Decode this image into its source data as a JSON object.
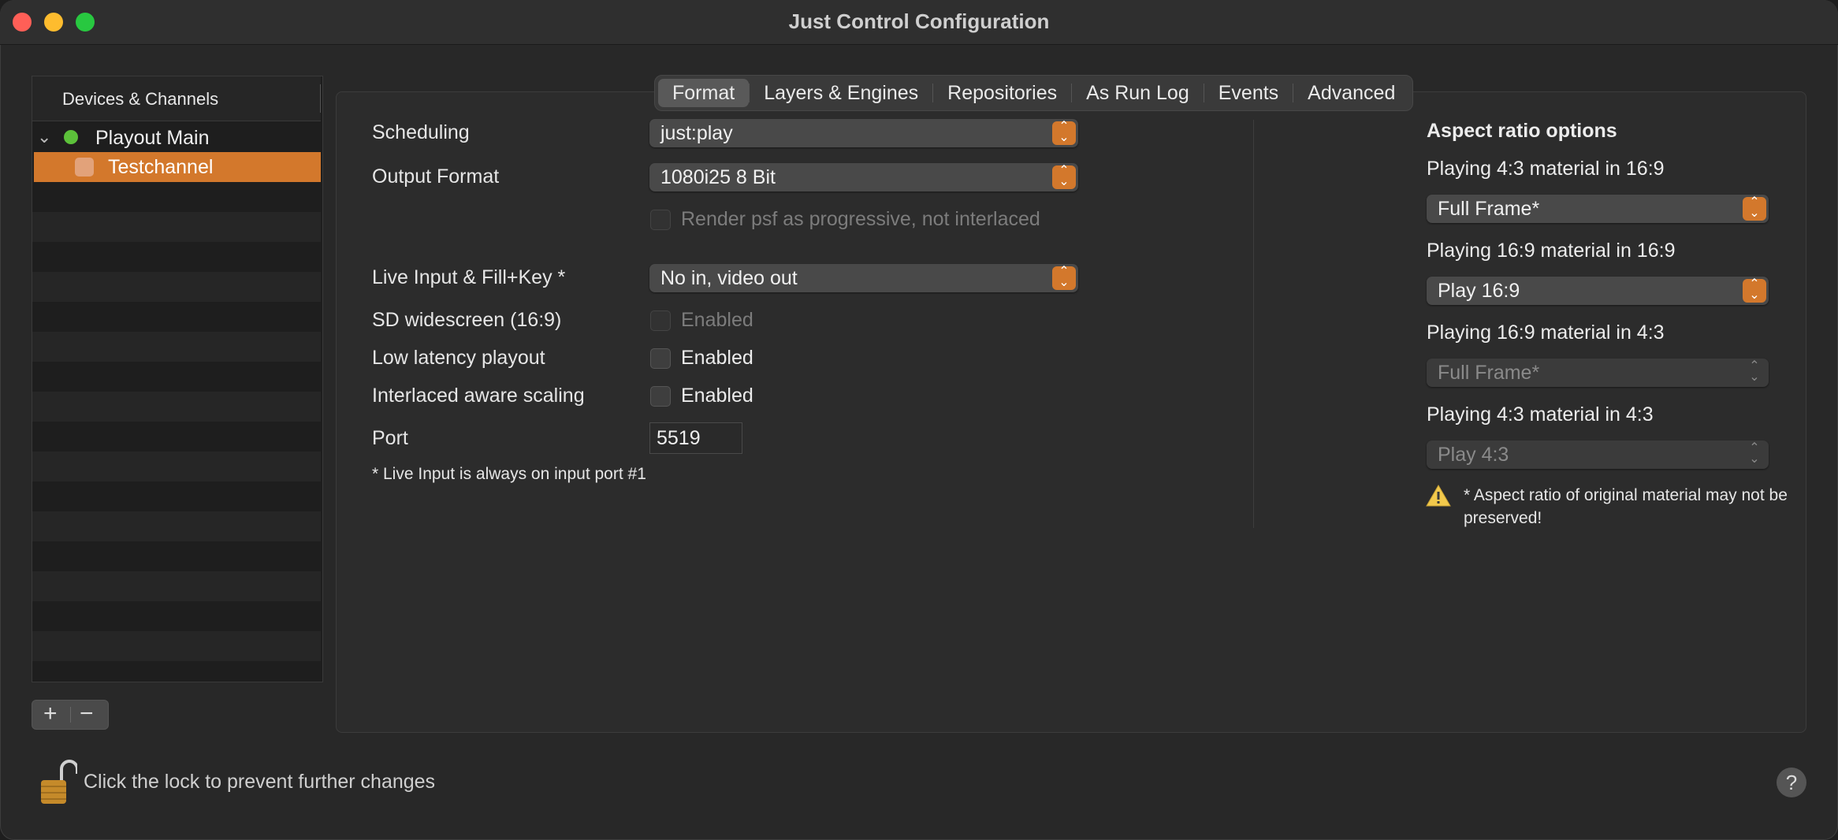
{
  "window": {
    "title": "Just Control Configuration"
  },
  "sidebar": {
    "header": "Devices & Channels",
    "items": [
      {
        "label": "Playout Main",
        "status_color": "#5cc13a"
      },
      {
        "label": "Testchannel",
        "selected": true
      }
    ],
    "add_icon": "plus-icon",
    "remove_icon": "minus-icon"
  },
  "tabs": [
    "Format",
    "Layers & Engines",
    "Repositories",
    "As Run Log",
    "Events",
    "Advanced"
  ],
  "active_tab": "Format",
  "format": {
    "scheduling": {
      "label": "Scheduling",
      "value": "just:play"
    },
    "output_format": {
      "label": "Output Format",
      "value": "1080i25 8 Bit"
    },
    "render_psf": {
      "label": "Render psf as progressive, not interlaced",
      "checked": false,
      "enabled": false
    },
    "live_input": {
      "label": "Live Input & Fill+Key *",
      "value": "No in, video out"
    },
    "sd_widescreen": {
      "label": "SD widescreen (16:9)",
      "checkbox_label": "Enabled",
      "checked": false,
      "enabled": false
    },
    "low_latency": {
      "label": "Low latency playout",
      "checkbox_label": "Enabled",
      "checked": false
    },
    "interlaced_scaling": {
      "label": "Interlaced aware scaling",
      "checkbox_label": "Enabled",
      "checked": false
    },
    "port": {
      "label": "Port",
      "value": "5519"
    },
    "note": "* Live Input is always on input port #1"
  },
  "aspect": {
    "title": "Aspect ratio options",
    "options": [
      {
        "label": "Playing 4:3 material in 16:9",
        "value": "Full Frame*",
        "enabled": true
      },
      {
        "label": "Playing 16:9 material in 16:9",
        "value": "Play 16:9",
        "enabled": true
      },
      {
        "label": "Playing 16:9 material in 4:3",
        "value": "Full Frame*",
        "enabled": false
      },
      {
        "label": "Playing 4:3 material in 4:3",
        "value": "Play 4:3",
        "enabled": false
      }
    ],
    "warning": "* Aspect ratio of original material may not be preserved!",
    "warning_icon": "warning-icon"
  },
  "footer": {
    "lock_text": "Click the lock to prevent further changes",
    "lock_icon": "lock-open-icon",
    "help": "?"
  },
  "colors": {
    "accent": "#d3782c",
    "status_green": "#5cc13a"
  }
}
